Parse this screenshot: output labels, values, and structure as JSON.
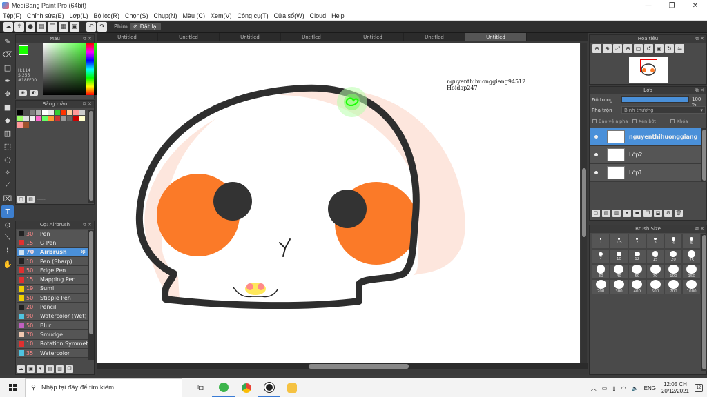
{
  "window": {
    "title": "MediBang Paint Pro (64bit)",
    "minimize": "—",
    "maximize": "❐",
    "close": "✕"
  },
  "menu": [
    "Tệp(F)",
    "Chỉnh sửa(E)",
    "Lớp(L)",
    "Bộ lọc(R)",
    "Chọn(S)",
    "Chụp(N)",
    "Màu (C)",
    "Xem(V)",
    "Công cụ(T)",
    "Cửa sổ(W)",
    "Cloud",
    "Help"
  ],
  "toolbar": {
    "phim_label": "Phím",
    "reset_label": "Đặt lại"
  },
  "color_panel": {
    "title": "Màu",
    "foreground": "#18FF00",
    "h_label": "H:114",
    "s_label": "S:255",
    "hex_label": "#18FF00"
  },
  "swatch_panel": {
    "title": "Bảng màu",
    "swatches": [
      "#000000",
      "#4d4d4d",
      "#808080",
      "#b3b3b3",
      "#ffffff",
      "#e8e8e8",
      "#33cc33",
      "#ff3300",
      "#ffcc99",
      "#ff9999",
      "#cccccc",
      "#99ff66",
      "#dddddd",
      "#f0f0f0",
      "#ff66cc",
      "#66ff66",
      "#ff9933",
      "#cc3333",
      "#999999",
      "#666666",
      "#cc0000",
      "#ffffcc",
      "#ff9999",
      "#a0522d"
    ],
    "footer_text": "----"
  },
  "brush_panel": {
    "title": "Cọ: Airbrush",
    "brushes": [
      {
        "size": "30",
        "name": "Pen",
        "color": "#222222",
        "selected": false
      },
      {
        "size": "15",
        "name": "G Pen",
        "color": "#e03030",
        "selected": false
      },
      {
        "size": "70",
        "name": "Airbrush",
        "color": "#cfe2f3",
        "selected": true
      },
      {
        "size": "10",
        "name": "Pen (Sharp)",
        "color": "#222222",
        "selected": false
      },
      {
        "size": "50",
        "name": "Edge Pen",
        "color": "#e03030",
        "selected": false
      },
      {
        "size": "15",
        "name": "Mapping Pen",
        "color": "#e03030",
        "selected": false
      },
      {
        "size": "19",
        "name": "Sumi",
        "color": "#f0d000",
        "selected": false
      },
      {
        "size": "50",
        "name": "Stipple Pen",
        "color": "#f0d000",
        "selected": false
      },
      {
        "size": "20",
        "name": "Pencil",
        "color": "#222222",
        "selected": false
      },
      {
        "size": "90",
        "name": "Watercolor (Wet)",
        "color": "#4fc3e0",
        "selected": false
      },
      {
        "size": "50",
        "name": "Blur",
        "color": "#c060c0",
        "selected": false
      },
      {
        "size": "70",
        "name": "Smudge",
        "color": "#f0c8b0",
        "selected": false
      },
      {
        "size": "10",
        "name": "Rotation Symmetry",
        "color": "#e03030",
        "selected": false
      },
      {
        "size": "35",
        "name": "Watercolor",
        "color": "#4fc3e0",
        "selected": false
      }
    ]
  },
  "canvas": {
    "tabs": [
      "Untitled",
      "Untitled",
      "Untitled",
      "Untitled",
      "Untitled",
      "Untitled",
      "Untitled"
    ],
    "active_tab": 6,
    "signature_line1": "nguyenthihuonggiang94512",
    "signature_line2": "Hoidap247"
  },
  "navigator": {
    "title": "Hoa tiêu"
  },
  "layer_panel": {
    "title": "Lớp",
    "opacity_label": "Độ trong",
    "opacity_value": "100 %",
    "opacity_fraction": 1.0,
    "blend_label": "Pha trộn",
    "blend_value": "Bình thường",
    "protect_alpha": "Bảo vệ alpha",
    "clipping": "Xén bớt",
    "lock": "Khóa",
    "layers": [
      {
        "name": "nguyenthihuonggiang",
        "selected": true
      },
      {
        "name": "Lớp2",
        "selected": false
      },
      {
        "name": "Lớp1",
        "selected": false
      }
    ]
  },
  "brush_size": {
    "title": "Brush Size",
    "sizes": [
      "1",
      "1.5",
      "2",
      "3",
      "4",
      "5",
      "7",
      "10",
      "12",
      "15",
      "20",
      "25",
      "30",
      "40",
      "50",
      "70",
      "100",
      "150",
      "200",
      "300",
      "400",
      "500",
      "700",
      "1000"
    ]
  },
  "taskbar": {
    "search_placeholder": "Nhập tại đây để tìm kiếm",
    "language": "ENG",
    "time": "12:05 CH",
    "date": "20/12/2021",
    "notifications": "12"
  }
}
